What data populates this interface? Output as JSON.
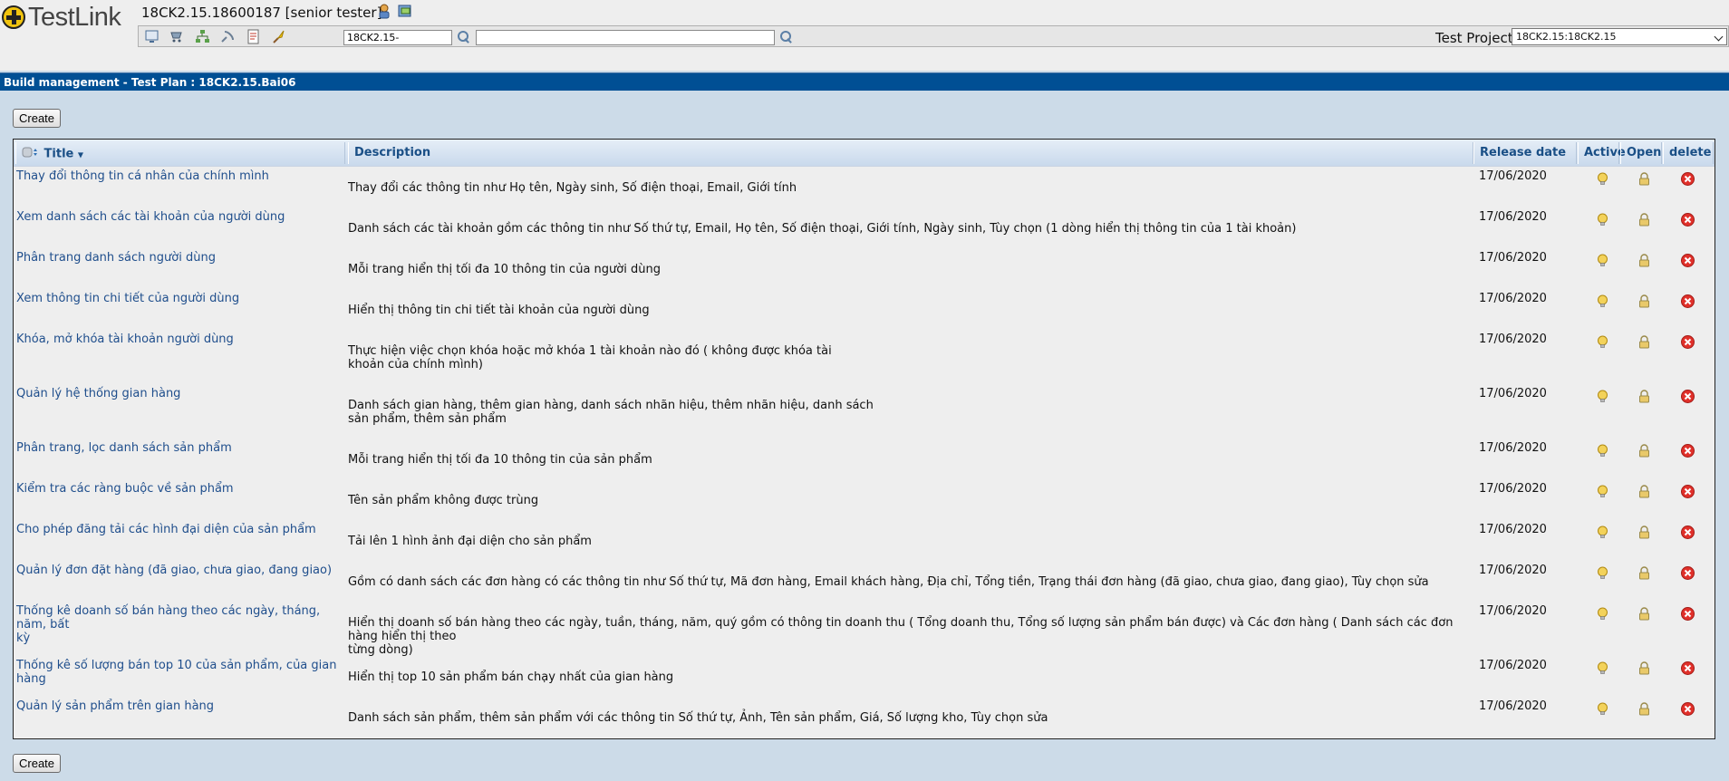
{
  "header": {
    "logo_text": "TestLink",
    "user_info": "18CK2.15.18600187 [senior tester]",
    "search_value": "18CK2.15-",
    "search2_value": "",
    "project_label": "Test Project",
    "project_value": "18CK2.15:18CK2.15"
  },
  "page": {
    "title": "Build management - Test Plan : 18CK2.15.Bai06",
    "create_label": "Create"
  },
  "table": {
    "columns": {
      "title": "Title",
      "description": "Description",
      "release_date": "Release date",
      "active": "Active",
      "open": "Open",
      "delete": "delete"
    },
    "rows": [
      {
        "title": "Thay đổi thông tin cá nhân của chính mình",
        "desc": "Thay đổi các thông tin như Họ tên, Ngày sinh, Số điện thoại, Email, Giới tính",
        "date": "17/06/2020"
      },
      {
        "title": "Xem danh sách các tài khoản của người dùng",
        "desc": "Danh sách các tài khoản gồm các thông tin như Số thứ tự, Email, Họ tên, Số điện thoại, Giới tính, Ngày sinh, Tùy chọn (1 dòng hiển thị thông tin của 1 tài khoản)",
        "date": "17/06/2020"
      },
      {
        "title": "Phân trang danh sách người dùng",
        "desc": "Mỗi trang hiển thị tối đa 10 thông tin của người dùng",
        "date": "17/06/2020"
      },
      {
        "title": "Xem thông tin chi tiết của người dùng",
        "desc": "Hiển thị thông tin chi tiết tài khoản của người dùng",
        "date": "17/06/2020"
      },
      {
        "title": "Khóa, mở khóa tài khoản người dùng",
        "desc": "Thực hiện việc chọn khóa hoặc mở khóa 1 tài khoản nào đó ( không được khóa tài\nkhoản của chính mình)",
        "date": "17/06/2020"
      },
      {
        "title": "Quản lý hệ thống gian hàng",
        "desc": "Danh sách gian hàng, thêm gian hàng, danh sách nhãn hiệu, thêm nhãn hiệu, danh sách\nsản phẩm, thêm sản phẩm",
        "date": "17/06/2020"
      },
      {
        "title": "Phân trang, lọc danh sách sản phẩm",
        "desc": "Mỗi trang hiển thị tối đa 10 thông tin của sản phẩm",
        "date": "17/06/2020"
      },
      {
        "title": "Kiểm tra các ràng buộc về sản phẩm",
        "desc": "Tên sản phẩm không được trùng",
        "date": "17/06/2020"
      },
      {
        "title": "Cho phép đăng tải các hình đại diện của sản phẩm",
        "desc": "Tải lên 1 hình ảnh đại diện cho sản phẩm",
        "date": "17/06/2020"
      },
      {
        "title": "Quản lý đơn đặt hàng (đã giao, chưa giao, đang giao)",
        "desc": "Gồm có danh sách các đơn hàng có các thông tin như Số thứ tự, Mã đơn hàng, Email khách hàng, Địa chỉ, Tổng tiền, Trạng thái đơn hàng (đã giao, chưa giao, đang giao), Tùy chọn sửa",
        "date": "17/06/2020"
      },
      {
        "title": "Thống kê doanh số bán hàng theo các ngày, tháng, năm, bất\nkỳ",
        "desc": "Hiển thị doanh số bán hàng theo các ngày, tuần, tháng, năm, quý gồm có thông tin doanh thu ( Tổng doanh thu, Tổng số lượng sản phẩm bán được) và Các đơn hàng ( Danh sách các đơn hàng hiển thị theo\ntừng dòng)",
        "date": "17/06/2020"
      },
      {
        "title": "Thống kê số lượng bán top 10 của sản phẩm, của gian hàng",
        "desc": "Hiển thị top 10 sản phẩm bán chạy nhất của gian hàng",
        "date": "17/06/2020"
      },
      {
        "title": "Quản lý sản phẩm trên gian hàng",
        "desc": "Danh sách sản phẩm, thêm sản phẩm với các thông tin Số thứ tự, Ảnh, Tên sản phẩm, Giá, Số lượng kho, Tùy chọn sửa",
        "date": "17/06/2020"
      }
    ]
  }
}
